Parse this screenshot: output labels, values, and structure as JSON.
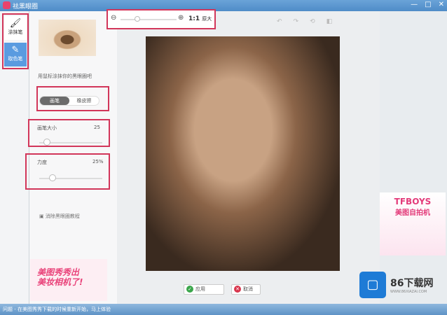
{
  "window": {
    "title": "祛黑眼圈",
    "controls": [
      "minimize",
      "maximize",
      "close"
    ]
  },
  "tools": [
    {
      "label": "涂抹笔",
      "icon": "brush-icon"
    },
    {
      "label": "取色笔",
      "icon": "eyedropper-icon"
    }
  ],
  "panel": {
    "caption": "用鼠标涂抹你的黑眼圈吧",
    "toggle": [
      "画笔",
      "橡皮擦"
    ],
    "brush_size_label": "画笔大小",
    "brush_size_value": "25",
    "brush_size_fraction": 0.25,
    "strength_label": "力度",
    "strength_value": "25%",
    "strength_fraction": 0.25,
    "tutorial": "消除黑眼圈教程"
  },
  "zoom": {
    "actual_size": "1:1",
    "actual_label": "原大",
    "level_fraction": 0.3
  },
  "actions": {
    "apply": "应用",
    "cancel": "取消"
  },
  "ads": {
    "left": [
      "美图秀秀出",
      "美妆相机了!"
    ],
    "right_title": "TFBOYS",
    "right_sub": "美图自拍机"
  },
  "watermark": {
    "name": "86下载网",
    "url": "WWW.86XIAZAI.COM"
  },
  "status": "问题 - 在美图秀秀下载的时候重新开始，马上体验"
}
